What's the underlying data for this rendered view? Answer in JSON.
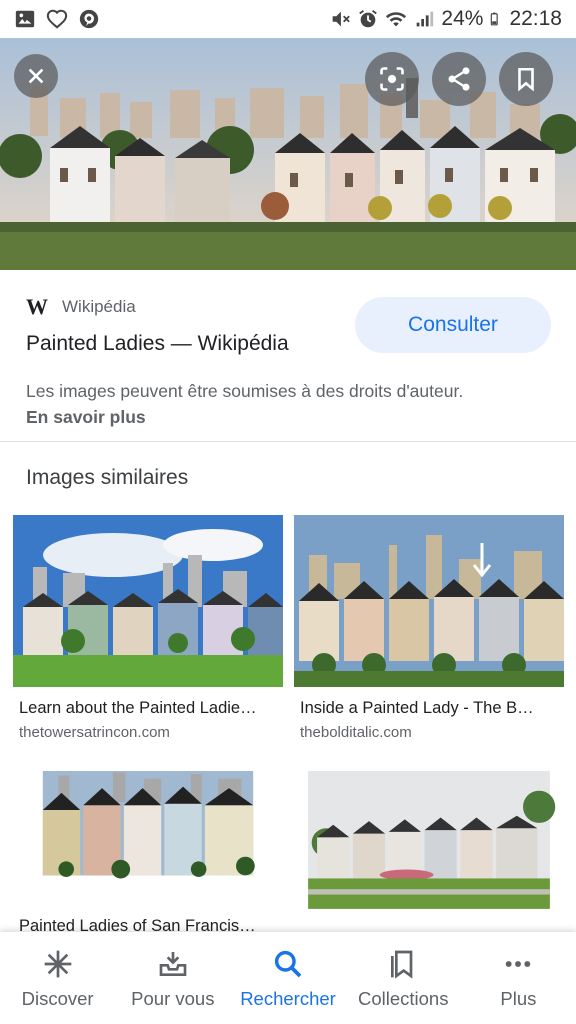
{
  "status_bar": {
    "battery": "24%",
    "time": "22:18",
    "icons": [
      "gallery-icon",
      "heart-icon",
      "pinterest-icon",
      "mute-icon",
      "alarm-icon",
      "wifi-icon",
      "signal-icon",
      "battery-icon"
    ]
  },
  "hero": {
    "actions": [
      "close-icon",
      "lens-icon",
      "share-icon",
      "bookmark-icon"
    ]
  },
  "source": {
    "logo": "W",
    "site_name": "Wikipédia",
    "title": "Painted Ladies — Wikipédia",
    "visit_label": "Consulter",
    "copyright_notice": "Les images peuvent être soumises à des droits d'auteur.",
    "learn_more": "En savoir plus"
  },
  "similar": {
    "heading": "Images similaires",
    "items": [
      {
        "caption": "Learn about the Painted Ladie…",
        "domain": "thetowersatrincon.com"
      },
      {
        "caption": "Inside a Painted Lady - The B…",
        "domain": "thebolditalic.com"
      },
      {
        "caption": "Painted Ladies of San Francis…",
        "domain": ""
      },
      {
        "caption": "",
        "domain": ""
      }
    ]
  },
  "bottom_nav": {
    "items": [
      {
        "label": "Discover",
        "icon": "asterisk-icon"
      },
      {
        "label": "Pour vous",
        "icon": "inbox-icon"
      },
      {
        "label": "Rechercher",
        "icon": "search-icon"
      },
      {
        "label": "Collections",
        "icon": "collections-icon"
      },
      {
        "label": "Plus",
        "icon": "more-icon"
      }
    ],
    "active": "Rechercher"
  },
  "colors": {
    "accent": "#1a73e8",
    "visit_button_bg": "#e8f0fe",
    "secondary_text": "#5f6368"
  }
}
